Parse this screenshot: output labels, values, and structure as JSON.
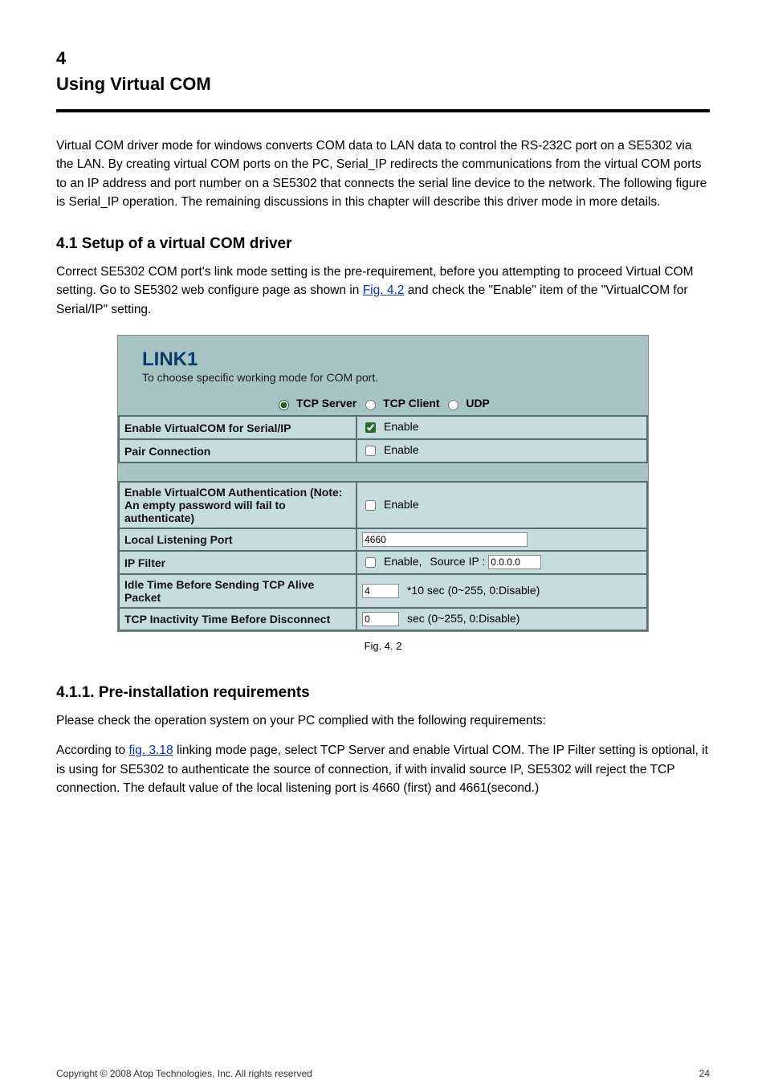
{
  "header": {
    "section_num": "4",
    "section_title": "Using Virtual COM"
  },
  "intro": {
    "p1": "Virtual COM driver mode for windows converts COM data to LAN data to control the RS-232C port on a SE5302 via the LAN. By creating virtual COM ports on the PC, Serial_IP redirects the communications from the virtual COM ports to an IP address and port number on a SE5302 that connects the serial line device to the network. The following figure is Serial_IP operation. The remaining discussions in this chapter will describe this driver mode in more details."
  },
  "sub1": {
    "title": "4.1 Setup of a virtual COM driver",
    "pre": "Correct SE5302 COM port's link mode setting is the pre-requirement, before you attempting to proceed Virtual COM setting. Go to SE5302 web configure page as shown in ",
    "ref": "Fig. 4.2",
    "post": " and check the \"Enable\" item of the \"VirtualCOM for Serial/IP\" setting."
  },
  "shot": {
    "title": "LINK1",
    "subtitle": "To choose specific working mode for COM port.",
    "modes": {
      "tcp_server": "TCP Server",
      "tcp_client": "TCP Client",
      "udp": "UDP"
    },
    "rows1": {
      "vcom_label": "Enable VirtualCOM for Serial/IP",
      "vcom_cb_label": "Enable",
      "pair_label": "Pair Connection",
      "pair_cb_label": "Enable"
    },
    "rows2": {
      "auth_label": "Enable VirtualCOM Authentication (Note: An empty password will fail to authenticate)",
      "auth_cb_label": "Enable",
      "port_label": "Local Listening Port",
      "port_value": "4660",
      "ipfilter_label": "IP Filter",
      "ipfilter_cb_label": "Enable,",
      "ipfilter_src_label": "Source IP :",
      "ipfilter_src_value": "0.0.0.0",
      "idle_label": "Idle Time Before Sending TCP Alive Packet",
      "idle_value": "4",
      "idle_suffix": "*10 sec (0~255, 0:Disable)",
      "inact_label": "TCP Inactivity Time Before Disconnect",
      "inact_value": "0",
      "inact_suffix": "sec (0~255, 0:Disable)"
    }
  },
  "fig_caption": "Fig. 4. 2",
  "sub2": {
    "title": "4.1.1. Pre-installation requirements",
    "p1": "Please check the operation system on your PC complied with the following requirements:",
    "p2_pre": "According to",
    "p2_ref": " fig. 3.18",
    "p2_post": " linking mode page, select TCP Server and enable Virtual COM. The IP Filter setting is optional, it is using for SE5302 to authenticate the source of connection, if with invalid source IP, SE5302 will reject the TCP connection. The default value of the local listening port is 4660 (first) and 4661(second.)"
  },
  "footer": {
    "copyright": "Copyright © 2008 Atop Technologies, Inc.  All rights reserved",
    "page": "24"
  }
}
